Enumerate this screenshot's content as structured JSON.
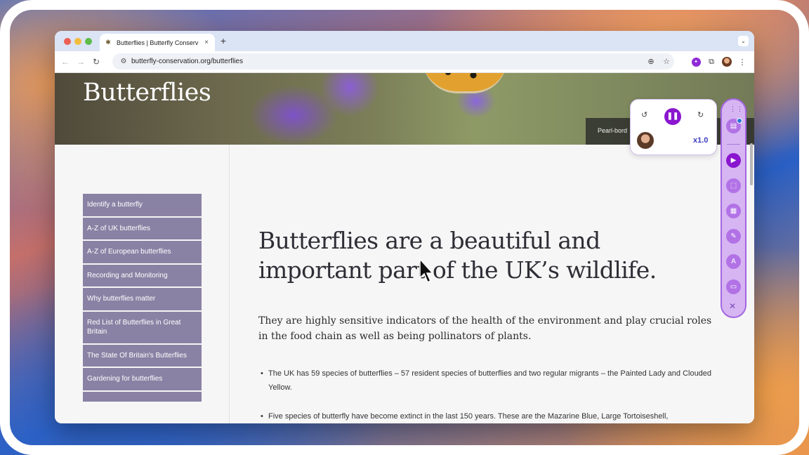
{
  "browser": {
    "tab_title": "Butterflies | Butterfly Conserv",
    "new_tab": "+",
    "url": "butterfly-conservation.org/butterflies"
  },
  "hero": {
    "title": "Butterflies",
    "caption": "Pearl-bord"
  },
  "sidenav": {
    "items": [
      "Identify a butterfly",
      "A-Z of UK butterflies",
      "A-Z of European butterflies",
      "Recording and Monitoring",
      "Why butterflies matter",
      "Red List of Butterflies in Great Britain",
      "The State Of Britain's Butterflies",
      "Gardening for butterflies"
    ]
  },
  "main": {
    "heading": "Butterflies are a beautiful and important part of the UK’s wildlife.",
    "intro": "They are highly sensitive indicators of the health of the environment and play crucial roles in the food chain as well as being pollinators of plants.",
    "bullets": [
      "The UK has 59 species of butterflies – 57 resident species of butterflies and two regular migrants – the Painted Lady and Clouded Yellow.",
      "Five species of butterfly have become extinct in the last 150 years. These are the Mazarine Blue, Large Tortoiseshell,"
    ]
  },
  "player": {
    "speed": "x1.0"
  },
  "colors": {
    "accent_purple": "#8a16cf",
    "nav_item_bg": "#8a82a4",
    "rail_bg": "#d6b5f2"
  },
  "icons": [
    "back-icon",
    "forward-icon",
    "reload-icon",
    "site-info-icon",
    "zoom-icon",
    "star-icon",
    "extension-icon",
    "puzzle-icon",
    "menu-icon",
    "rewind-icon",
    "pause-icon",
    "forward-skip-icon",
    "book-icon",
    "play-icon",
    "capture-icon",
    "calculator-icon",
    "highlighter-icon",
    "translate-icon",
    "screen-icon",
    "close-icon"
  ]
}
